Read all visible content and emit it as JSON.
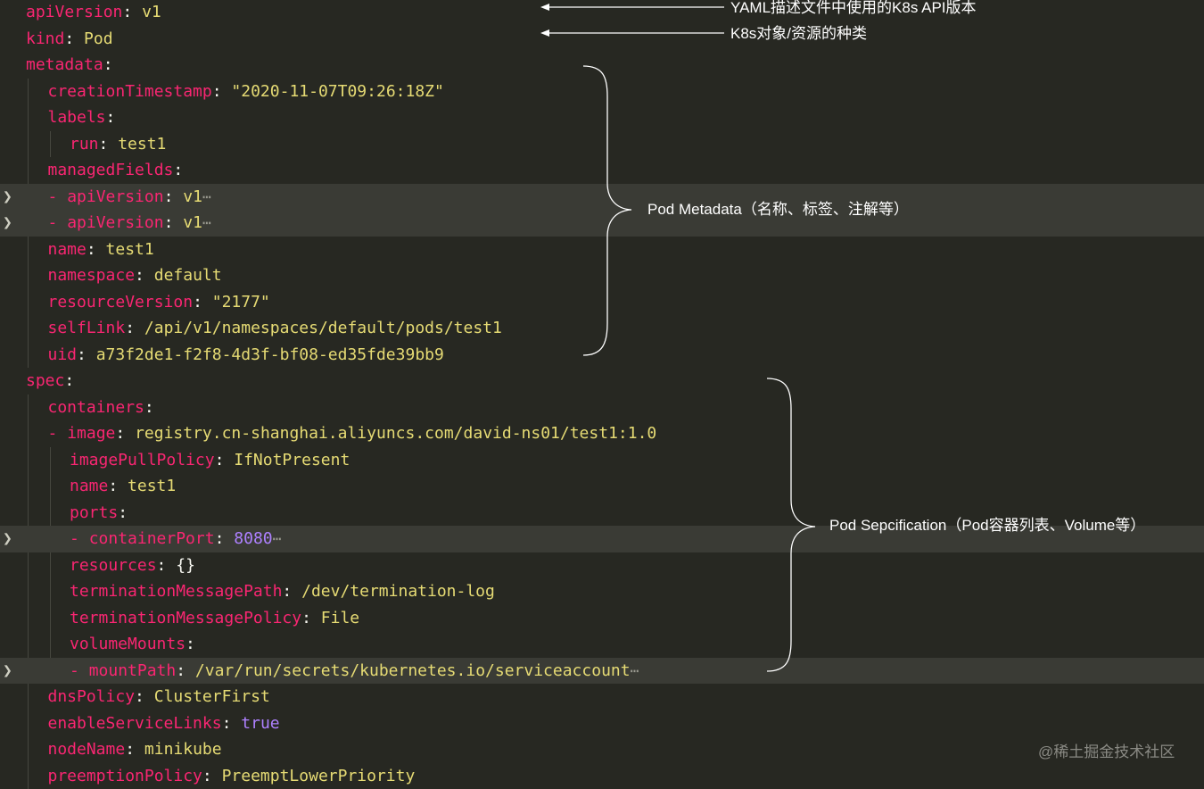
{
  "lines": [
    {
      "indent": 0,
      "key": "apiVersion",
      "value": "v1",
      "valType": "val"
    },
    {
      "indent": 0,
      "key": "kind",
      "value": "Pod",
      "valType": "val"
    },
    {
      "indent": 0,
      "key": "metadata",
      "value": "",
      "valType": "val"
    },
    {
      "indent": 1,
      "key": "creationTimestamp",
      "value": "\"2020-11-07T09:26:18Z\"",
      "valType": "val"
    },
    {
      "indent": 1,
      "key": "labels",
      "value": "",
      "valType": "val"
    },
    {
      "indent": 2,
      "key": "run",
      "value": "test1",
      "valType": "val"
    },
    {
      "indent": 1,
      "key": "managedFields",
      "value": "",
      "valType": "val"
    },
    {
      "indent": 1,
      "dash": true,
      "key": "apiVersion",
      "value": "v1",
      "valType": "val",
      "folded": true
    },
    {
      "indent": 1,
      "dash": true,
      "key": "apiVersion",
      "value": "v1",
      "valType": "val",
      "folded": true
    },
    {
      "indent": 1,
      "key": "name",
      "value": "test1",
      "valType": "val"
    },
    {
      "indent": 1,
      "key": "namespace",
      "value": "default",
      "valType": "val"
    },
    {
      "indent": 1,
      "key": "resourceVersion",
      "value": "\"2177\"",
      "valType": "val"
    },
    {
      "indent": 1,
      "key": "selfLink",
      "value": "/api/v1/namespaces/default/pods/test1",
      "valType": "val"
    },
    {
      "indent": 1,
      "key": "uid",
      "value": "a73f2de1-f2f8-4d3f-bf08-ed35fde39bb9",
      "valType": "val"
    },
    {
      "indent": 0,
      "key": "spec",
      "value": "",
      "valType": "val"
    },
    {
      "indent": 1,
      "key": "containers",
      "value": "",
      "valType": "val"
    },
    {
      "indent": 1,
      "dash": true,
      "key": "image",
      "value": "registry.cn-shanghai.aliyuncs.com/david-ns01/test1:1.0",
      "valType": "val"
    },
    {
      "indent": 2,
      "key": "imagePullPolicy",
      "value": "IfNotPresent",
      "valType": "val"
    },
    {
      "indent": 2,
      "key": "name",
      "value": "test1",
      "valType": "val"
    },
    {
      "indent": 2,
      "key": "ports",
      "value": "",
      "valType": "val"
    },
    {
      "indent": 2,
      "dash": true,
      "key": "containerPort",
      "value": "8080",
      "valType": "num",
      "folded": true
    },
    {
      "indent": 2,
      "key": "resources",
      "value": "{}",
      "valType": "plain"
    },
    {
      "indent": 2,
      "key": "terminationMessagePath",
      "value": "/dev/termination-log",
      "valType": "val"
    },
    {
      "indent": 2,
      "key": "terminationMessagePolicy",
      "value": "File",
      "valType": "val"
    },
    {
      "indent": 2,
      "key": "volumeMounts",
      "value": "",
      "valType": "val"
    },
    {
      "indent": 2,
      "dash": true,
      "key": "mountPath",
      "value": "/var/run/secrets/kubernetes.io/serviceaccount",
      "valType": "val",
      "folded": true
    },
    {
      "indent": 1,
      "key": "dnsPolicy",
      "value": "ClusterFirst",
      "valType": "val"
    },
    {
      "indent": 1,
      "key": "enableServiceLinks",
      "value": "true",
      "valType": "bool"
    },
    {
      "indent": 1,
      "key": "nodeName",
      "value": "minikube",
      "valType": "val"
    },
    {
      "indent": 1,
      "key": "preemptionPolicy",
      "value": "PreemptLowerPriority",
      "valType": "val"
    }
  ],
  "annotations": {
    "api_version": "YAML描述文件中使用的K8s API版本",
    "kind": "K8s对象/资源的种类",
    "metadata": "Pod Metadata（名称、标签、注解等）",
    "spec": "Pod Sepcification（Pod容器列表、Volume等）"
  },
  "fold_glyph": "❯",
  "ellipsis": "⋯",
  "watermark": "@稀土掘金技术社区",
  "colors": {
    "background": "#272822",
    "key": "#f92672",
    "string": "#e6db74",
    "number": "#ae81ff",
    "text": "#f8f8f2",
    "highlight": "#3a3b35"
  }
}
